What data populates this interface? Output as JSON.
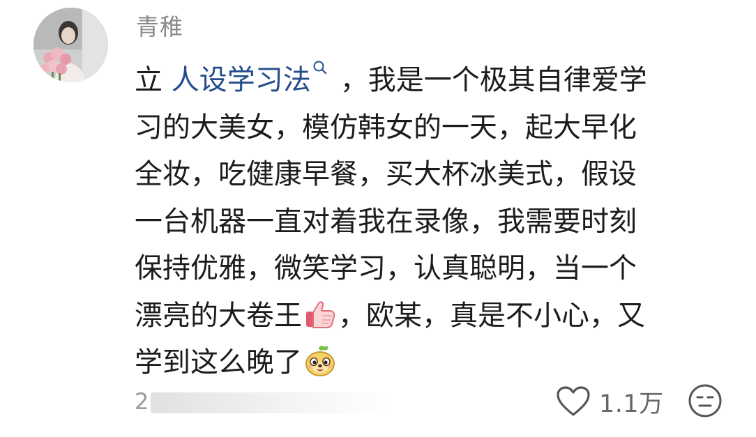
{
  "comment": {
    "username": "青稚",
    "line1_prefix": "立",
    "topic_link": "人设学习法",
    "line1_suffix": "，我是一个极其自律爱学",
    "line2": "习的大美女，模仿韩女的一天，起大早化",
    "line3": "全妆，吃健康早餐，买大杯冰美式，假设",
    "line4": "一台机器一直对着我在录像，我需要时刻",
    "line5": "保持优雅，微笑学习，认真聪明，当一个",
    "line6_prefix": "漂亮的大卷王",
    "line6_suffix": "，欧某，真是不小心，又",
    "line7": "学到这么晚了",
    "emoji_1": "thumbs-up-emoji",
    "emoji_2": "yellow-dog-emoji",
    "topic_link_icon": "search-icon"
  },
  "footer": {
    "time_visible": "2",
    "like_count": "1.1万",
    "like_icon": "heart-outline-icon",
    "dislike_icon": "meh-face-icon"
  },
  "colors": {
    "link": "#244c8c",
    "username": "#8a8a8a",
    "body_text": "#1c1c1c",
    "meta": "#999999"
  }
}
